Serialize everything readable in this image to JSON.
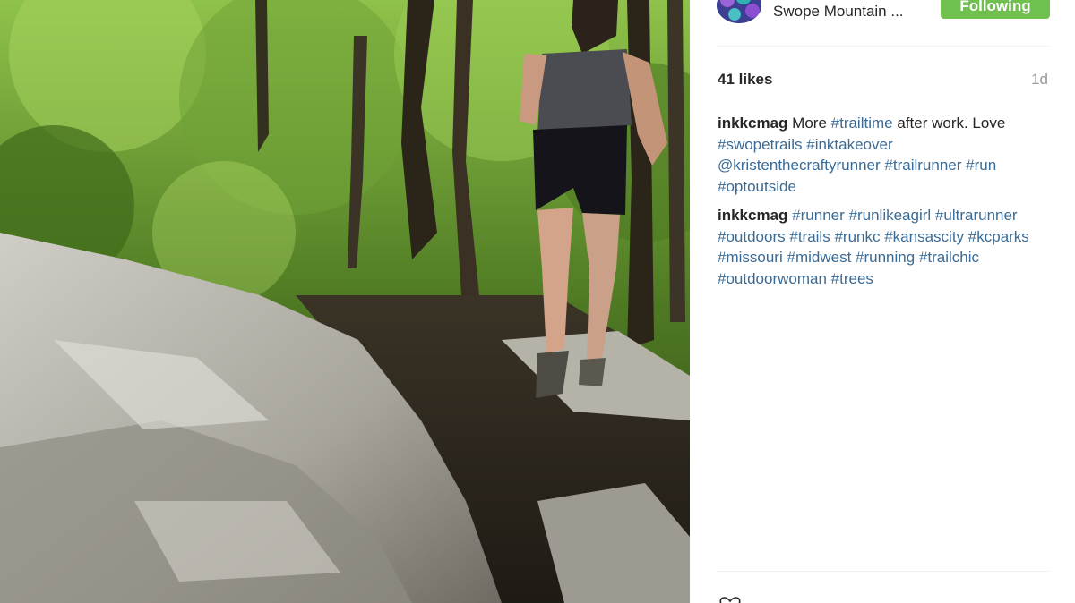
{
  "header": {
    "location": "Swope Mountain ...",
    "follow_label": "Following"
  },
  "post": {
    "likes": "41 likes",
    "time_ago": "1d"
  },
  "comments": [
    {
      "user": "inkkcmag",
      "parts": [
        {
          "type": "text",
          "value": "More"
        },
        {
          "type": "tag",
          "value": "#trailtime"
        },
        {
          "type": "text",
          "value": "after work. Love"
        },
        {
          "type": "tag",
          "value": "#swopetrails"
        },
        {
          "type": "tag",
          "value": "#inktakeover"
        },
        {
          "type": "tag",
          "value": "@kristenthecraftyrunner"
        },
        {
          "type": "tag",
          "value": "#trailrunner"
        },
        {
          "type": "tag",
          "value": "#run"
        },
        {
          "type": "tag",
          "value": "#optoutside"
        }
      ]
    },
    {
      "user": "inkkcmag",
      "parts": [
        {
          "type": "tag",
          "value": "#runner"
        },
        {
          "type": "tag",
          "value": "#runlikeagirl"
        },
        {
          "type": "tag",
          "value": "#ultrarunner"
        },
        {
          "type": "tag",
          "value": "#outdoors"
        },
        {
          "type": "tag",
          "value": "#trails"
        },
        {
          "type": "tag",
          "value": "#runkc"
        },
        {
          "type": "tag",
          "value": "#kansascity"
        },
        {
          "type": "tag",
          "value": "#kcparks"
        },
        {
          "type": "tag",
          "value": "#missouri"
        },
        {
          "type": "tag",
          "value": "#midwest"
        },
        {
          "type": "tag",
          "value": "#running"
        },
        {
          "type": "tag",
          "value": "#trailchic"
        },
        {
          "type": "tag",
          "value": "#outdoorwoman"
        },
        {
          "type": "tag",
          "value": "#trees"
        }
      ]
    }
  ],
  "icons": {
    "like": "heart-icon"
  },
  "colors": {
    "follow_button": "#70c050",
    "hashtag": "#3b6b95",
    "text": "#262626",
    "muted": "#999999"
  }
}
